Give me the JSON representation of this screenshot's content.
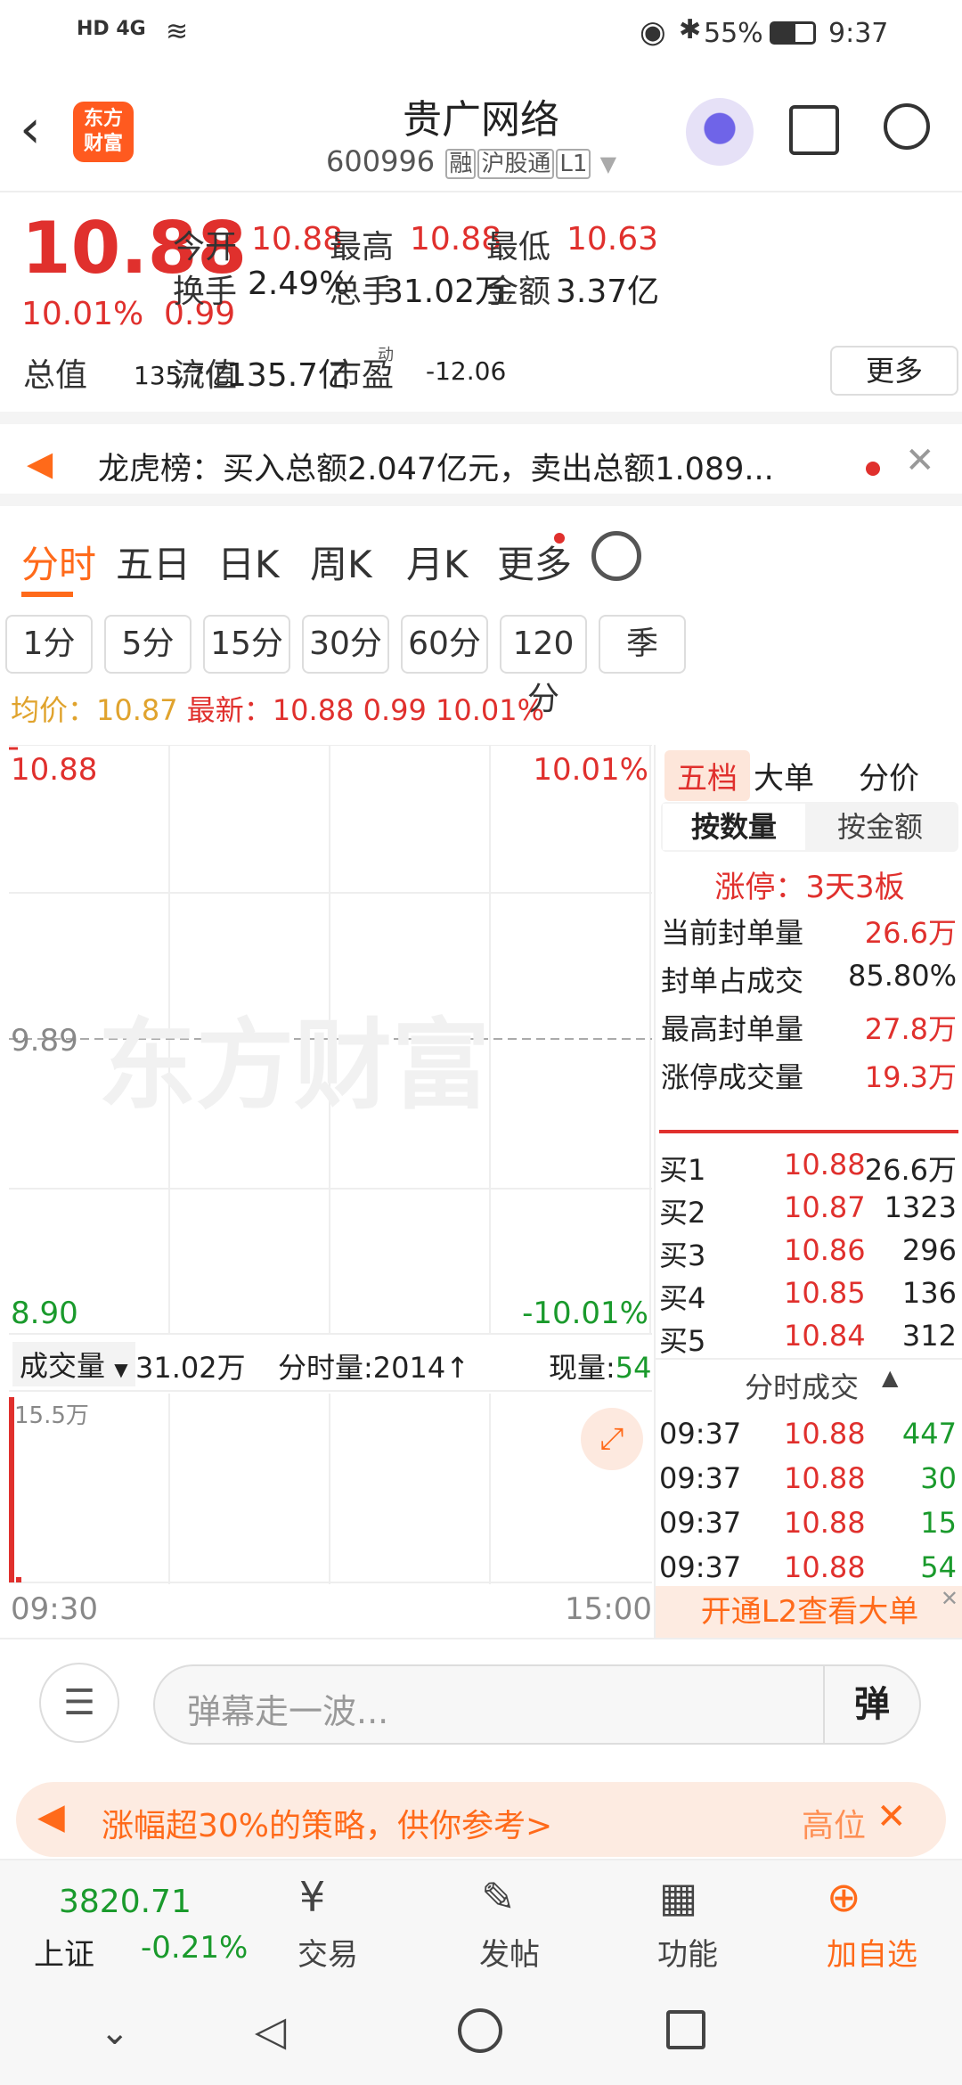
{
  "status": {
    "net": "HD 4G",
    "battery": "55%",
    "time": "9:37"
  },
  "header": {
    "back": "back",
    "logo": "东方\n财富",
    "title": "贵广网络",
    "code": "600996",
    "tags": [
      "融",
      "沪股通",
      "L1"
    ]
  },
  "quote": {
    "price": "10.88",
    "change_pct": "10.01%",
    "change": "0.99",
    "r1": [
      [
        "今开",
        "10.88"
      ],
      [
        "最高",
        "10.88"
      ],
      [
        "最低",
        "10.63"
      ]
    ],
    "r2": [
      [
        "换手",
        "2.49%"
      ],
      [
        "总手",
        "31.02万"
      ],
      [
        "金额",
        "3.37亿"
      ]
    ],
    "r3": [
      [
        "总值",
        "135.7亿"
      ],
      [
        "流值",
        "135.7亿"
      ],
      [
        "市盈",
        "-12.06"
      ]
    ],
    "pe_sup": "动",
    "more": "更多"
  },
  "notice": {
    "text": "龙虎榜：买入总额2.047亿元，卖出总额1.089..."
  },
  "tabs": [
    "分时",
    "五日",
    "日K",
    "周K",
    "月K",
    "更多"
  ],
  "periods": [
    "1分",
    "5分",
    "15分",
    "30分",
    "60分",
    "120分",
    "季"
  ],
  "avg": {
    "avg_label": "均价：",
    "avg_val": "10.87",
    "latest_label": "最新：",
    "latest_val": "10.88",
    "chg": "0.99",
    "pct": "10.01%"
  },
  "chart_data": {
    "type": "line",
    "price_top": "10.88",
    "price_mid": "9.89",
    "price_bot": "8.90",
    "pct_top": "10.01%",
    "pct_bot": "-10.01%",
    "watermark": "东方财富",
    "x_start": "09:30",
    "x_end": "15:00",
    "vol_label": "成交量",
    "vol_total": "31.02万",
    "tick_vol_label": "分时量:2014",
    "arrow": "↑",
    "now_label": "现量:",
    "now_val": "54",
    "vol_max": "15.5万"
  },
  "panel": {
    "tabs": [
      "五档",
      "大单",
      "分价"
    ],
    "sub": [
      "按数量",
      "按金额"
    ],
    "limit": "涨停：3天3板",
    "stats": [
      [
        "当前封单量",
        "26.6万"
      ],
      [
        "封单占成交",
        "85.80%"
      ],
      [
        "最高封单量",
        "27.8万"
      ],
      [
        "涨停成交量",
        "19.3万"
      ]
    ],
    "bids": [
      [
        "买1",
        "10.88",
        "26.6万"
      ],
      [
        "买2",
        "10.87",
        "1323"
      ],
      [
        "买3",
        "10.86",
        "296"
      ],
      [
        "买4",
        "10.85",
        "136"
      ],
      [
        "买5",
        "10.84",
        "312"
      ]
    ],
    "ticks_title": "分时成交",
    "ticks": [
      [
        "09:37",
        "10.88",
        "447"
      ],
      [
        "09:37",
        "10.88",
        "30"
      ],
      [
        "09:37",
        "10.88",
        "15"
      ],
      [
        "09:37",
        "10.88",
        "54"
      ]
    ],
    "l2": "开通L2查看大单"
  },
  "comment": {
    "placeholder": "弹幕走一波...",
    "btn": "弹"
  },
  "banner": {
    "text": "涨幅超30%的策略，供你参考>",
    "right": "高位"
  },
  "bottom": {
    "index": "3820.71",
    "index_name": "上证",
    "index_chg": "-0.21%",
    "items": [
      "交易",
      "发帖",
      "功能",
      "加自选"
    ]
  }
}
